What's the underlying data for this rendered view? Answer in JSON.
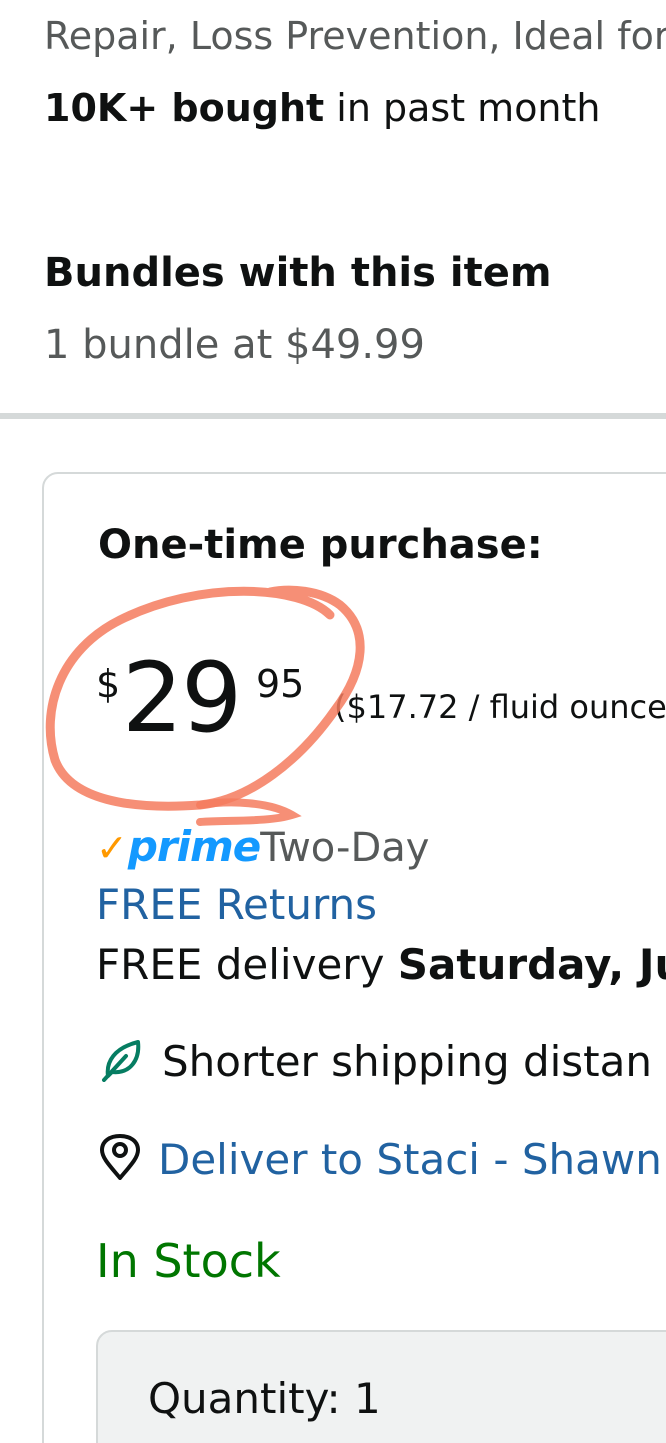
{
  "product": {
    "description_tail": "Repair, Loss Prevention, Ideal for",
    "bought_bold": "10K+ bought",
    "bought_rest": " in past month"
  },
  "bundles": {
    "title": "Bundles with this item",
    "subtitle": "1 bundle at $49.99"
  },
  "buybox": {
    "purchase_label": "One-time purchase:",
    "price": {
      "symbol": "$",
      "whole": "29",
      "fraction": "95",
      "unit_price": "($17.72 / fluid ounce)"
    },
    "prime": {
      "check": "✓",
      "logo_text": "prime",
      "speed": "Two-Day"
    },
    "free_returns": "FREE Returns",
    "delivery_prefix": "FREE delivery ",
    "delivery_date": "Saturday, Ju",
    "shorter_shipping": "Shorter shipping distan",
    "deliver_to": "Deliver to Staci - Shawn",
    "stock_status": "In Stock",
    "quantity_label": "Quantity:",
    "quantity_value": "1"
  },
  "colors": {
    "link": "#2162a1",
    "in_stock": "#007600",
    "prime_blue": "#1399ff",
    "prime_orange": "#ff9900",
    "annotation": "#f47b5e",
    "eco_green": "#067d62"
  },
  "icons": {
    "eco": "leaf-icon",
    "location": "location-pin-icon"
  }
}
